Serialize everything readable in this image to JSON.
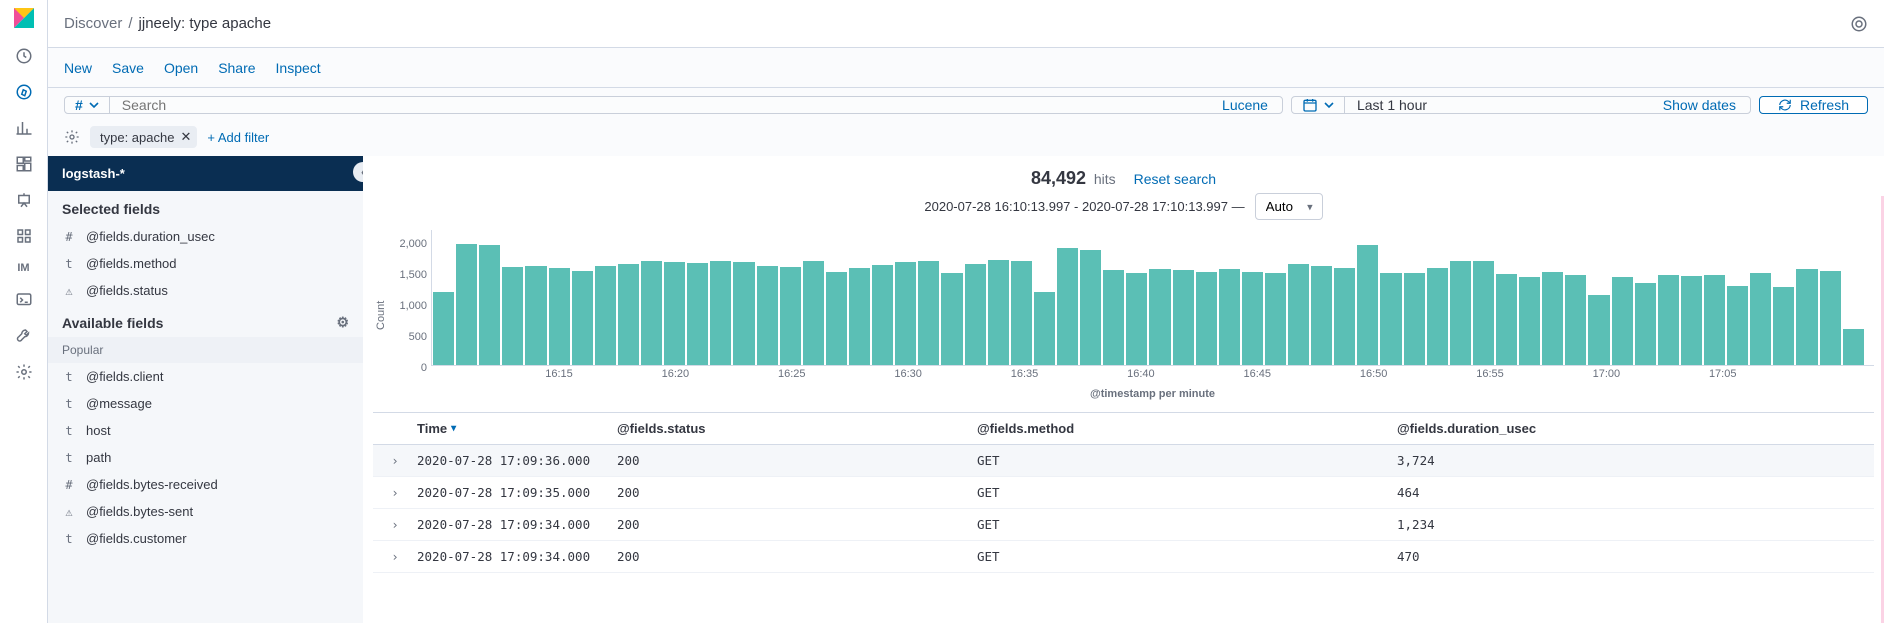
{
  "breadcrumb": {
    "root": "Discover",
    "current": "jjneely: type apache"
  },
  "toolbar": {
    "new": "New",
    "save": "Save",
    "open": "Open",
    "share": "Share",
    "inspect": "Inspect"
  },
  "query": {
    "prefix": "#",
    "placeholder": "Search",
    "language": "Lucene"
  },
  "datepicker": {
    "value": "Last 1 hour",
    "show_dates": "Show dates"
  },
  "refresh_label": "Refresh",
  "filters": {
    "pill": "type: apache",
    "add": "+ Add filter"
  },
  "sidebar": {
    "index_pattern": "logstash-*",
    "selected_header": "Selected fields",
    "available_header": "Available fields",
    "popular_header": "Popular",
    "selected": [
      {
        "type": "#",
        "name": "@fields.duration_usec"
      },
      {
        "type": "t",
        "name": "@fields.method"
      },
      {
        "type": "⚠",
        "name": "@fields.status"
      }
    ],
    "popular": [
      {
        "type": "t",
        "name": "@fields.client"
      },
      {
        "type": "t",
        "name": "@message"
      },
      {
        "type": "t",
        "name": "host"
      },
      {
        "type": "t",
        "name": "path"
      },
      {
        "type": "#",
        "name": "@fields.bytes-received"
      },
      {
        "type": "⚠",
        "name": "@fields.bytes-sent"
      },
      {
        "type": "t",
        "name": "@fields.customer"
      }
    ]
  },
  "hits": {
    "count": "84,492",
    "label": "hits",
    "reset": "Reset search"
  },
  "time_range": "2020-07-28 16:10:13.997 - 2020-07-28 17:10:13.997 —",
  "interval": "Auto",
  "chart_data": {
    "type": "bar",
    "xlabel": "@timestamp per minute",
    "ylabel": "Count",
    "ylim": [
      0,
      2000
    ],
    "yticks": [
      "2,000",
      "1,500",
      "1,000",
      "500",
      "0"
    ],
    "xticks": [
      "16:15",
      "16:20",
      "16:25",
      "16:30",
      "16:35",
      "16:40",
      "16:45",
      "16:50",
      "16:55",
      "17:00",
      "17:05"
    ],
    "values": [
      1080,
      1800,
      1780,
      1450,
      1460,
      1430,
      1400,
      1470,
      1500,
      1540,
      1530,
      1510,
      1540,
      1520,
      1460,
      1450,
      1540,
      1380,
      1430,
      1480,
      1530,
      1540,
      1370,
      1490,
      1560,
      1540,
      1080,
      1730,
      1700,
      1410,
      1370,
      1420,
      1410,
      1380,
      1420,
      1380,
      1360,
      1490,
      1460,
      1430,
      1780,
      1370,
      1360,
      1430,
      1540,
      1540,
      1350,
      1310,
      1380,
      1340,
      1030,
      1310,
      1220,
      1340,
      1320,
      1330,
      1170,
      1370,
      1160,
      1420,
      1400,
      530
    ]
  },
  "table": {
    "columns": [
      "Time",
      "@fields.status",
      "@fields.method",
      "@fields.duration_usec"
    ],
    "rows": [
      {
        "time": "2020-07-28 17:09:36.000",
        "status": "200",
        "method": "GET",
        "duration": "3,724"
      },
      {
        "time": "2020-07-28 17:09:35.000",
        "status": "200",
        "method": "GET",
        "duration": "464"
      },
      {
        "time": "2020-07-28 17:09:34.000",
        "status": "200",
        "method": "GET",
        "duration": "1,234"
      },
      {
        "time": "2020-07-28 17:09:34.000",
        "status": "200",
        "method": "GET",
        "duration": "470"
      }
    ]
  }
}
